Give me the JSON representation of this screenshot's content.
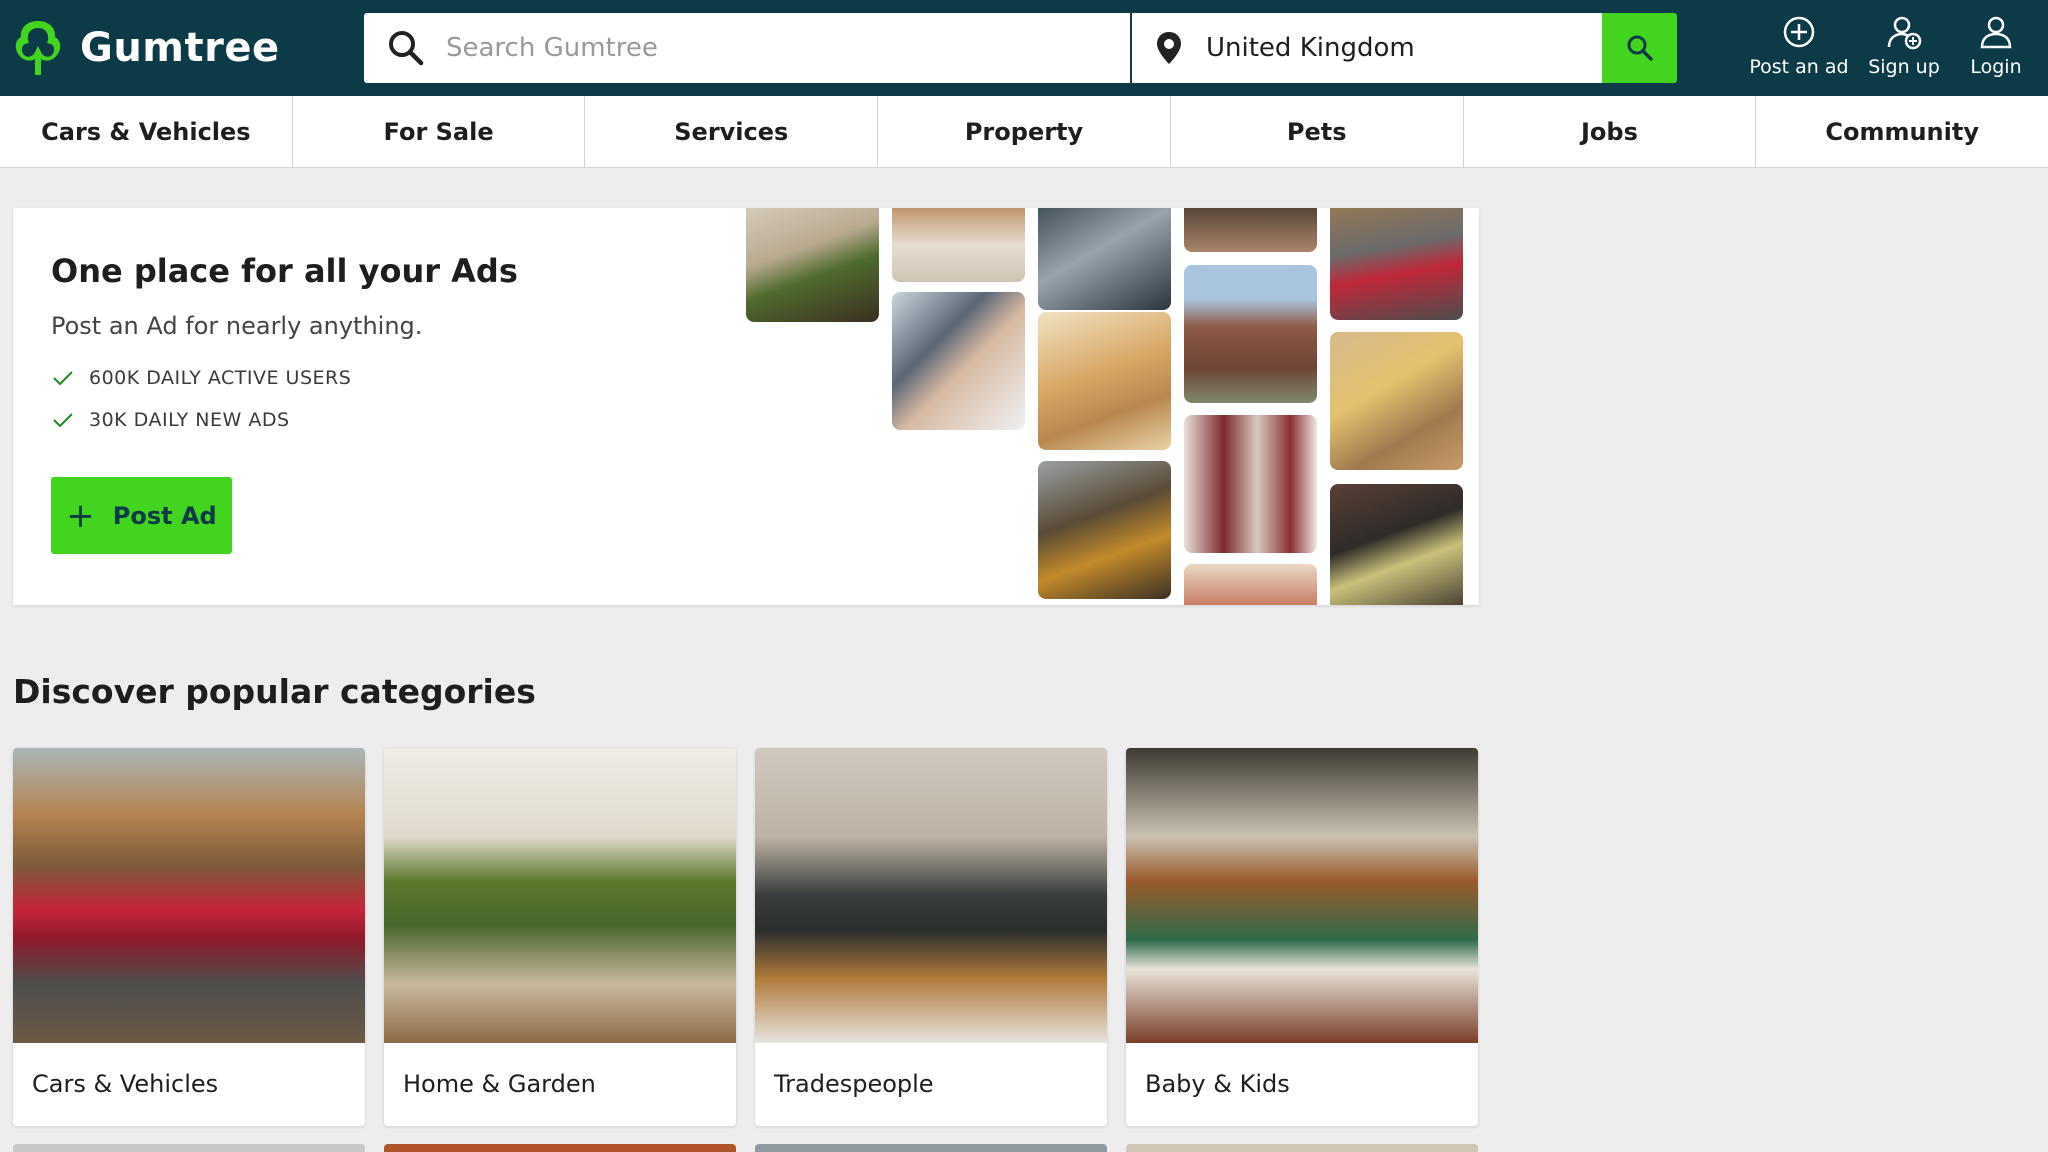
{
  "brand": {
    "name": "Gumtree",
    "accent": "#43d41f",
    "header_bg": "#0d3a47"
  },
  "search": {
    "placeholder": "Search Gumtree",
    "location": "United Kingdom"
  },
  "header_actions": [
    {
      "label": "Post an ad",
      "icon": "plus-circle-icon"
    },
    {
      "label": "Sign up",
      "icon": "user-add-icon"
    },
    {
      "label": "Login",
      "icon": "user-icon"
    }
  ],
  "nav": [
    "Cars & Vehicles",
    "For Sale",
    "Services",
    "Property",
    "Pets",
    "Jobs",
    "Community"
  ],
  "hero": {
    "title": "One place for all your Ads",
    "subtitle": "Post an Ad for nearly anything.",
    "bullets": [
      "600K DAILY ACTIVE USERS",
      "30K DAILY NEW ADS"
    ],
    "cta": "Post Ad"
  },
  "popular": {
    "title": "Discover popular categories",
    "cards": [
      "Cars & Vehicles",
      "Home & Garden",
      "Tradespeople",
      "Baby & Kids"
    ]
  }
}
